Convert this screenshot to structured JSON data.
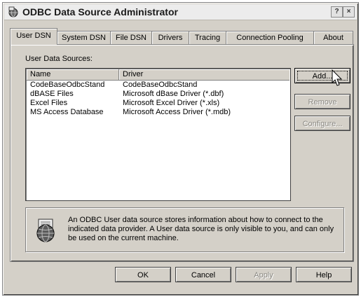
{
  "window": {
    "title": "ODBC Data Source Administrator",
    "help_glyph": "?",
    "close_glyph": "×"
  },
  "tabs": [
    {
      "label": "User DSN",
      "active": true
    },
    {
      "label": "System DSN",
      "active": false
    },
    {
      "label": "File DSN",
      "active": false
    },
    {
      "label": "Drivers",
      "active": false
    },
    {
      "label": "Tracing",
      "active": false
    },
    {
      "label": "Connection Pooling",
      "active": false
    },
    {
      "label": "About",
      "active": false
    }
  ],
  "user_dsn": {
    "section_label": "User Data Sources:",
    "columns": [
      "Name",
      "Driver"
    ],
    "rows": [
      {
        "name": "CodeBaseOdbcStand",
        "driver": "CodeBaseOdbcStand"
      },
      {
        "name": "dBASE Files",
        "driver": "Microsoft dBase Driver (*.dbf)"
      },
      {
        "name": "Excel Files",
        "driver": "Microsoft Excel Driver (*.xls)"
      },
      {
        "name": "MS Access Database",
        "driver": "Microsoft Access Driver (*.mdb)"
      }
    ],
    "buttons": {
      "add": "Add...",
      "remove": "Remove",
      "configure": "Configure..."
    },
    "info_text": "An ODBC User data source stores information about how to connect to the indicated data provider.  A User data source is only visible to you, and can only be used on the current machine."
  },
  "footer": {
    "ok": "OK",
    "cancel": "Cancel",
    "apply": "Apply",
    "help": "Help"
  },
  "icons": {
    "app": "odbc-app-icon",
    "info": "globe-icon"
  }
}
